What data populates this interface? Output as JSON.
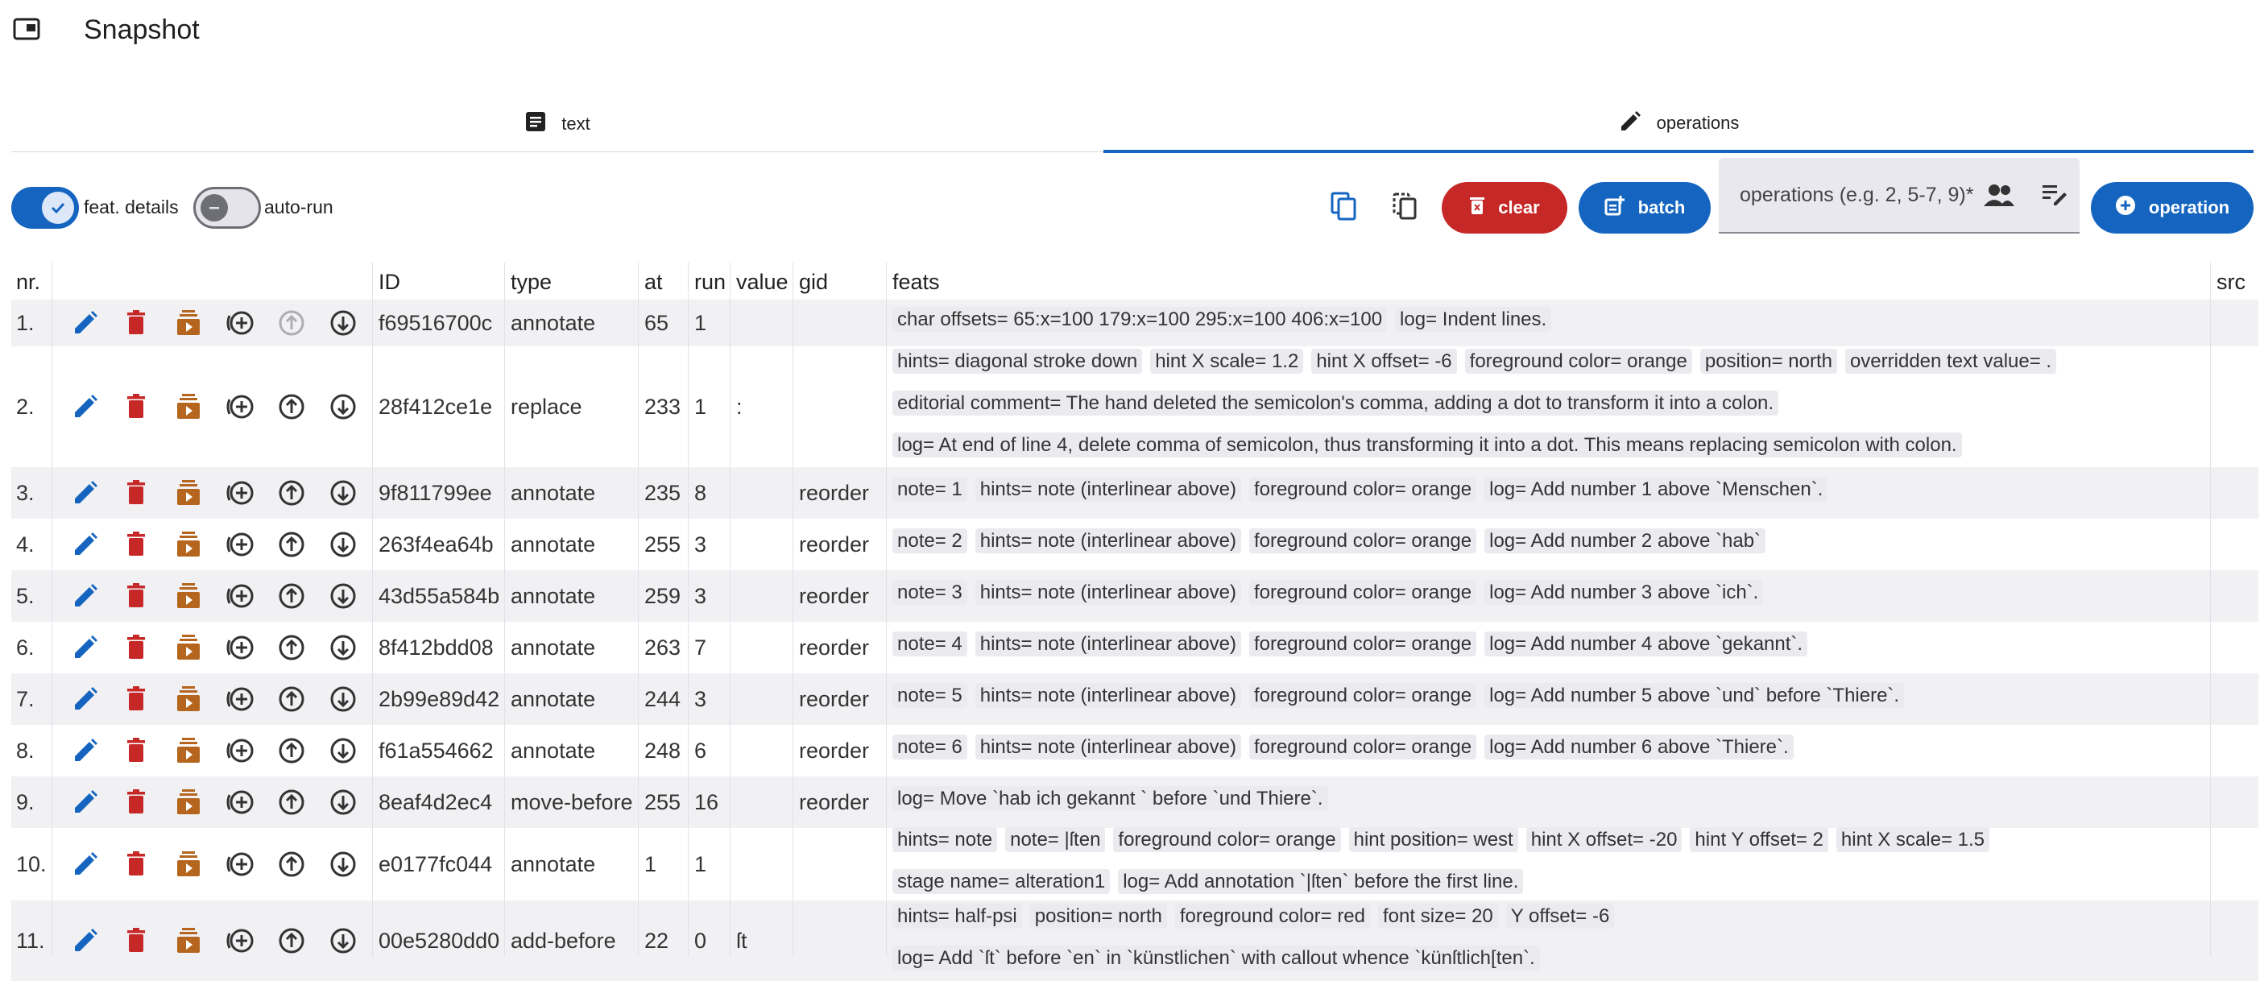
{
  "app": {
    "title": "Snapshot"
  },
  "tabs": [
    {
      "label": "text"
    },
    {
      "label": "operations"
    }
  ],
  "toggles": {
    "feat_details": "feat. details",
    "auto_run": "auto-run"
  },
  "toolbar": {
    "clear_label": "clear",
    "batch_label": "batch",
    "operation_label": "operation",
    "ops_placeholder": "operations (e.g. 2, 5-7, 9)*"
  },
  "colors": {
    "primary": "#1565c0",
    "danger": "#c62828",
    "edit": "#1565c0",
    "delete": "#c62828",
    "run": "#b5651d"
  },
  "table": {
    "headers": {
      "nr": "nr.",
      "id": "ID",
      "type": "type",
      "at": "at",
      "run": "run",
      "value": "value",
      "gid": "gid",
      "feats": "feats",
      "src": "src"
    },
    "rows": [
      {
        "nr": "1.",
        "id": "f69516700c",
        "type": "annotate",
        "at": "65",
        "run": "1",
        "value": "",
        "gid": "",
        "feats": [
          [
            "char offsets= 65:x=100 179:x=100 295:x=100 406:x=100",
            "log= Indent lines."
          ]
        ]
      },
      {
        "nr": "2.",
        "id": "28f412ce1e",
        "type": "replace",
        "at": "233",
        "run": "1",
        "value": ":",
        "gid": "",
        "feats": [
          [
            "hints= diagonal stroke down",
            "hint X scale= 1.2",
            "hint X offset= -6",
            "foreground color= orange",
            "position= north",
            "overridden text value= ."
          ],
          [
            "editorial comment= The hand deleted the semicolon's comma, adding a dot to transform it into a colon."
          ],
          [
            "log= At end of line 4, delete comma of semicolon, thus transforming it into a dot. This means replacing semicolon with colon."
          ]
        ]
      },
      {
        "nr": "3.",
        "id": "9f811799ee",
        "type": "annotate",
        "at": "235",
        "run": "8",
        "value": "",
        "gid": "reorder",
        "feats": [
          [
            "note= 1",
            "hints= note (interlinear above)",
            "foreground color= orange",
            "log= Add number 1 above `Menschen`."
          ]
        ]
      },
      {
        "nr": "4.",
        "id": "263f4ea64b",
        "type": "annotate",
        "at": "255",
        "run": "3",
        "value": "",
        "gid": "reorder",
        "feats": [
          [
            "note= 2",
            "hints= note (interlinear above)",
            "foreground color= orange",
            "log= Add number 2 above `hab`"
          ]
        ]
      },
      {
        "nr": "5.",
        "id": "43d55a584b",
        "type": "annotate",
        "at": "259",
        "run": "3",
        "value": "",
        "gid": "reorder",
        "feats": [
          [
            "note= 3",
            "hints= note (interlinear above)",
            "foreground color= orange",
            "log= Add number 3 above `ich`."
          ]
        ]
      },
      {
        "nr": "6.",
        "id": "8f412bdd08",
        "type": "annotate",
        "at": "263",
        "run": "7",
        "value": "",
        "gid": "reorder",
        "feats": [
          [
            "note= 4",
            "hints= note (interlinear above)",
            "foreground color= orange",
            "log= Add number 4 above `gekannt`."
          ]
        ]
      },
      {
        "nr": "7.",
        "id": "2b99e89d42",
        "type": "annotate",
        "at": "244",
        "run": "3",
        "value": "",
        "gid": "reorder",
        "feats": [
          [
            "note= 5",
            "hints= note (interlinear above)",
            "foreground color= orange",
            "log= Add number 5 above `und` before `Thiere`."
          ]
        ]
      },
      {
        "nr": "8.",
        "id": "f61a554662",
        "type": "annotate",
        "at": "248",
        "run": "6",
        "value": "",
        "gid": "reorder",
        "feats": [
          [
            "note= 6",
            "hints= note (interlinear above)",
            "foreground color= orange",
            "log= Add number 6 above `Thiere`."
          ]
        ]
      },
      {
        "nr": "9.",
        "id": "8eaf4d2ec4",
        "type": "move-before",
        "at": "255",
        "run": "16",
        "value": "",
        "gid": "reorder",
        "feats": [
          [
            "log= Move `hab ich gekannt ` before `und Thiere`."
          ]
        ]
      },
      {
        "nr": "10.",
        "id": "e0177fc044",
        "type": "annotate",
        "at": "1",
        "run": "1",
        "value": "",
        "gid": "",
        "feats": [
          [
            "hints= note",
            "note= |ſten",
            "foreground color= orange",
            "hint position= west",
            "hint X offset= -20",
            "hint Y offset= 2",
            "hint X scale= 1.5"
          ],
          [
            "stage name= alteration1",
            "log= Add annotation `|ſten` before the first line."
          ]
        ]
      },
      {
        "nr": "11.",
        "id": "00e5280dd0",
        "type": "add-before",
        "at": "22",
        "run": "0",
        "value": "ſt",
        "gid": "",
        "feats": [
          [
            "hints= half-psi",
            "position= north",
            "foreground color= red",
            "font size= 20",
            "Y offset= -6"
          ],
          [
            "log= Add `ſt` before `en` in `künstlichen` with callout whence `künſtlich[ten`."
          ]
        ]
      }
    ]
  }
}
